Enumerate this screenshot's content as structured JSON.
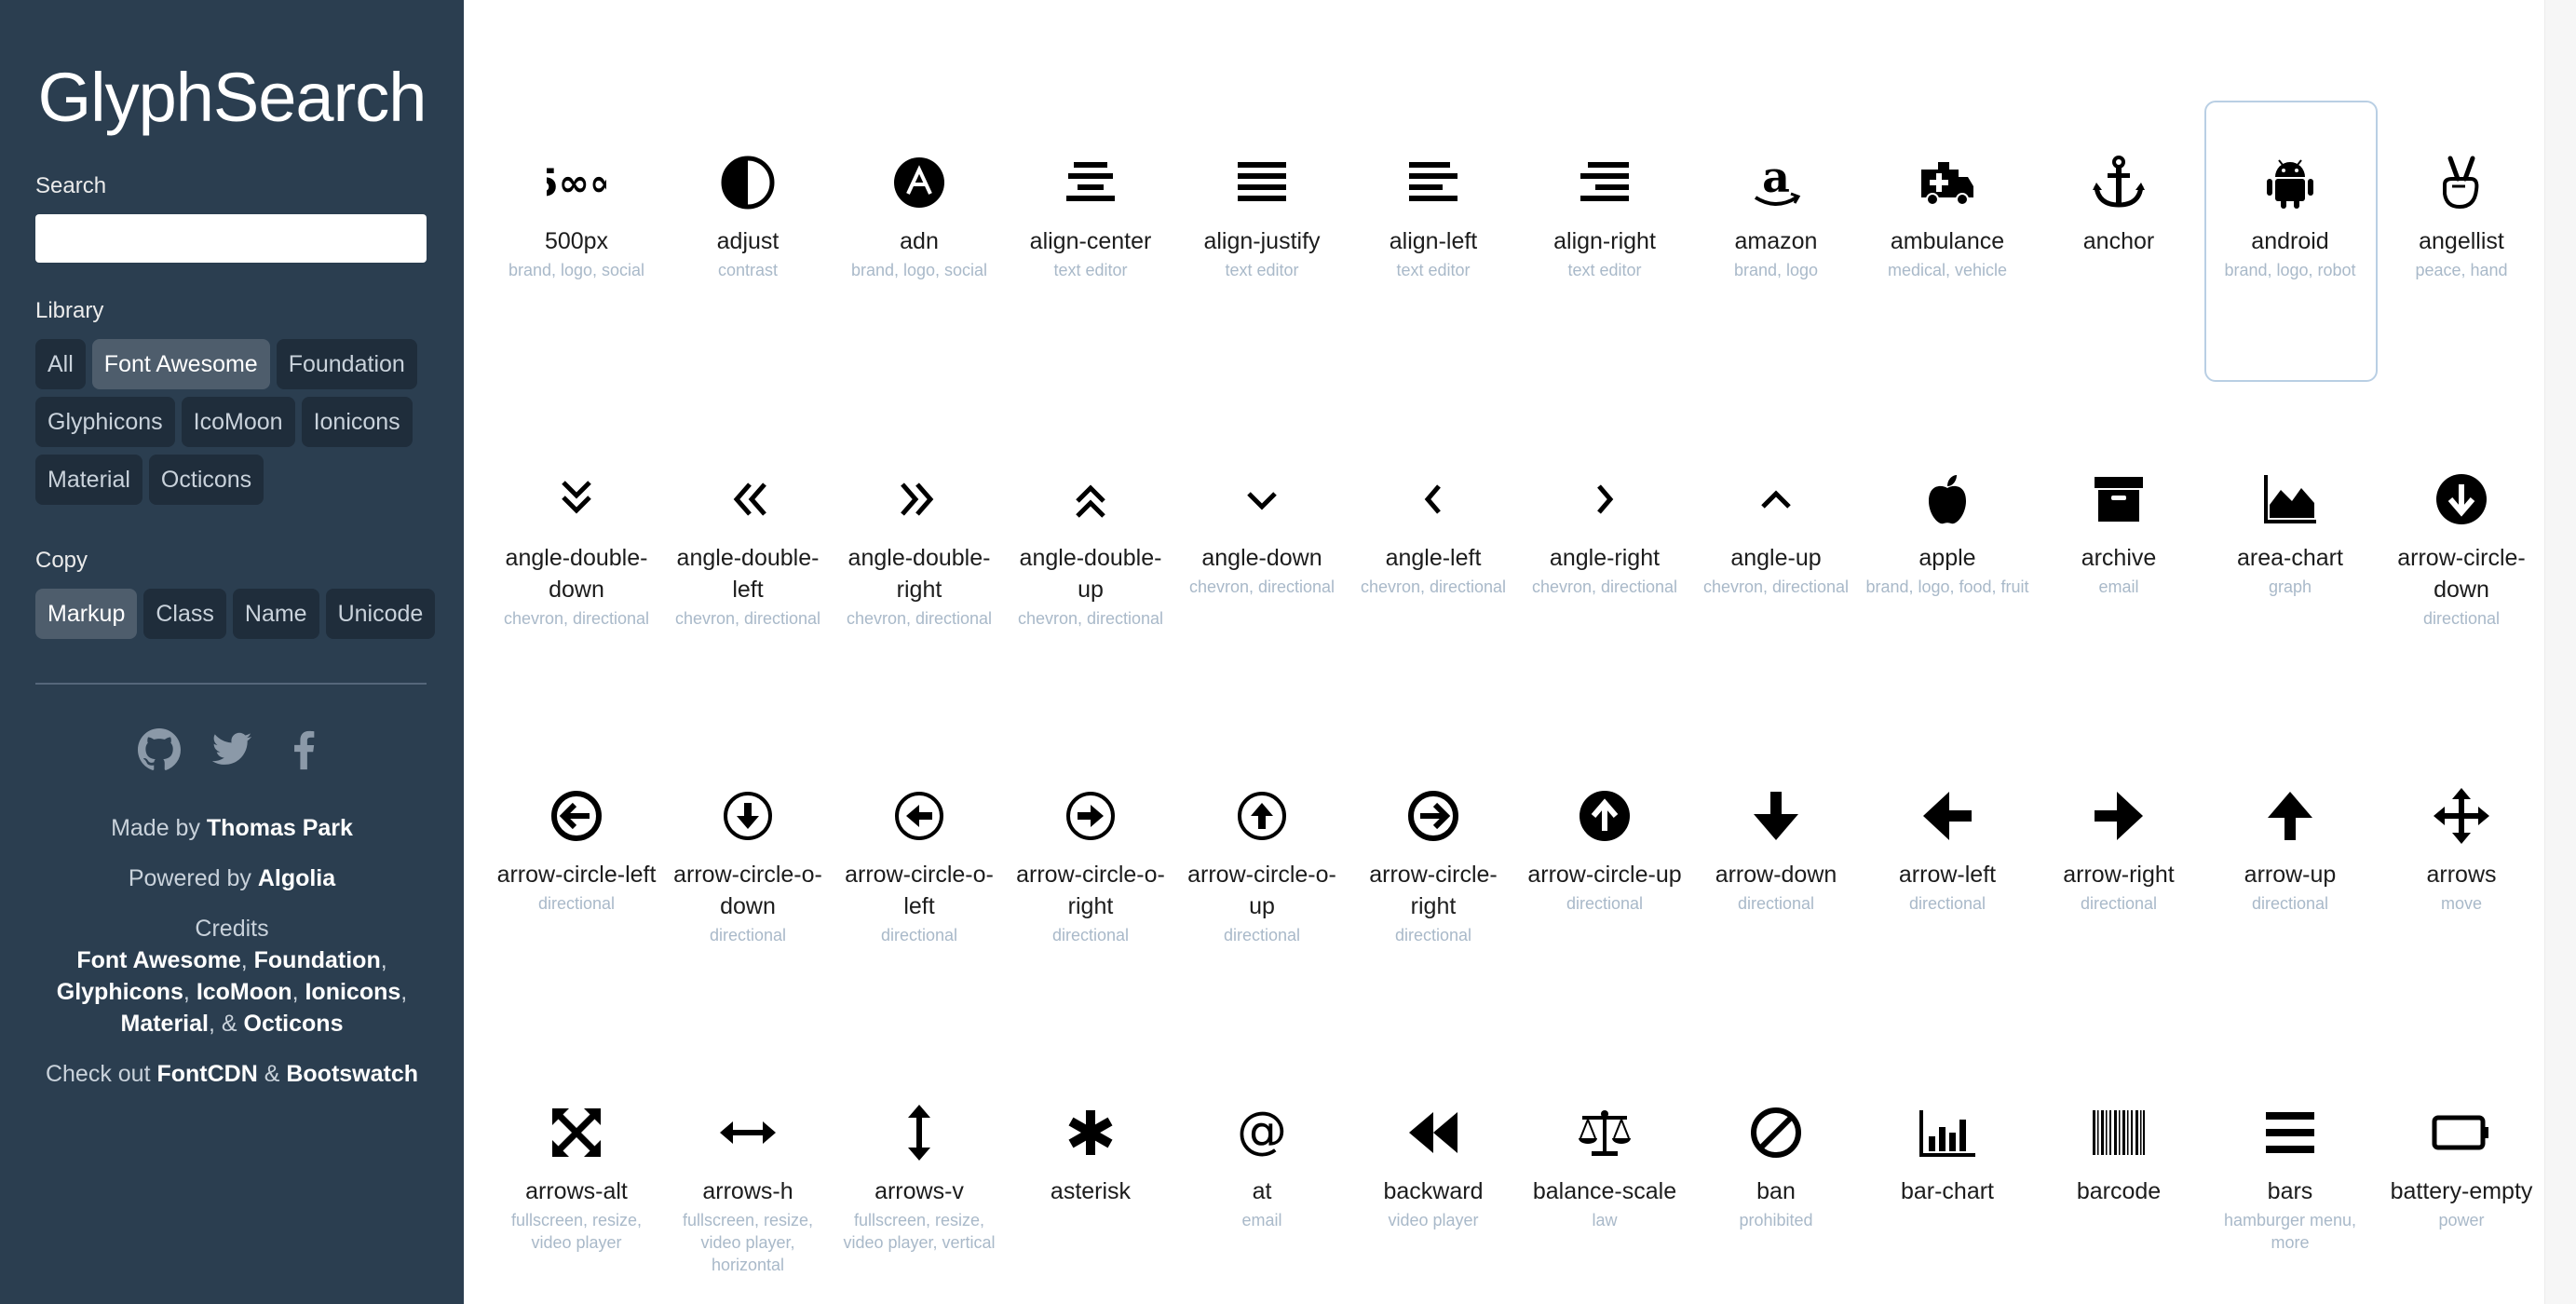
{
  "app": {
    "title": "GlyphSearch"
  },
  "search": {
    "label": "Search",
    "placeholder": "",
    "value": ""
  },
  "library": {
    "label": "Library",
    "rows": [
      [
        {
          "label": "All",
          "active": false
        },
        {
          "label": "Font Awesome",
          "active": true
        },
        {
          "label": "Foundation",
          "active": false
        }
      ],
      [
        {
          "label": "Glyphicons",
          "active": false
        },
        {
          "label": "IcoMoon",
          "active": false
        },
        {
          "label": "Ionicons",
          "active": false
        }
      ],
      [
        {
          "label": "Material",
          "active": false
        },
        {
          "label": "Octicons",
          "active": false
        }
      ]
    ]
  },
  "copy": {
    "label": "Copy",
    "options": [
      {
        "label": "Markup",
        "active": true
      },
      {
        "label": "Class",
        "active": false
      },
      {
        "label": "Name",
        "active": false
      },
      {
        "label": "Unicode",
        "active": false
      }
    ]
  },
  "social": [
    {
      "icon": "github-icon"
    },
    {
      "icon": "twitter-icon"
    },
    {
      "icon": "facebook-icon"
    }
  ],
  "footer": {
    "made_by_prefix": "Made by ",
    "made_by_name": "Thomas Park",
    "powered_prefix": "Powered by ",
    "powered_name": "Algolia",
    "credits_title": "Credits",
    "credits_line1_a": "Font Awesome",
    "credits_line1_sep": ", ",
    "credits_line1_b": "Foundation",
    "credits_line1_end": ",",
    "credits_line2_a": "Glyphicons",
    "credits_line2_b": "IcoMoon",
    "credits_line2_c": "Ionicons",
    "credits_line3_a": "Material",
    "credits_line3_amp": ", & ",
    "credits_line3_b": "Octicons",
    "checkout_prefix": "Check out ",
    "checkout_a": "FontCDN",
    "checkout_amp": " & ",
    "checkout_b": "Bootswatch"
  },
  "colors": {
    "sidebar_bg": "#2b3e50",
    "pill_bg": "#1f2d3b",
    "pill_active_bg": "#4e5d6c",
    "tag_text": "#a9b9c9",
    "selected_border": "#b9cfe4"
  },
  "icons": [
    {
      "name": "500px",
      "tags": "brand, logo, social",
      "glyph": "500px"
    },
    {
      "name": "adjust",
      "tags": "contrast",
      "glyph": "adjust"
    },
    {
      "name": "adn",
      "tags": "brand, logo, social",
      "glyph": "adn"
    },
    {
      "name": "align-center",
      "tags": "text editor",
      "glyph": "align-center"
    },
    {
      "name": "align-justify",
      "tags": "text editor",
      "glyph": "align-justify"
    },
    {
      "name": "align-left",
      "tags": "text editor",
      "glyph": "align-left"
    },
    {
      "name": "align-right",
      "tags": "text editor",
      "glyph": "align-right"
    },
    {
      "name": "amazon",
      "tags": "brand, logo",
      "glyph": "amazon"
    },
    {
      "name": "ambulance",
      "tags": "medical, vehicle",
      "glyph": "ambulance"
    },
    {
      "name": "anchor",
      "tags": "",
      "glyph": "anchor"
    },
    {
      "name": "android",
      "tags": "brand, logo, robot",
      "glyph": "android",
      "selected": true
    },
    {
      "name": "angellist",
      "tags": "peace, hand",
      "glyph": "angellist"
    },
    {
      "name": "angle-double-down",
      "tags": "chevron, directional",
      "glyph": "angle-double-down"
    },
    {
      "name": "angle-double-left",
      "tags": "chevron, directional",
      "glyph": "angle-double-left"
    },
    {
      "name": "angle-double-right",
      "tags": "chevron, directional",
      "glyph": "angle-double-right"
    },
    {
      "name": "angle-double-up",
      "tags": "chevron, directional",
      "glyph": "angle-double-up"
    },
    {
      "name": "angle-down",
      "tags": "chevron, directional",
      "glyph": "angle-down"
    },
    {
      "name": "angle-left",
      "tags": "chevron, directional",
      "glyph": "angle-left"
    },
    {
      "name": "angle-right",
      "tags": "chevron, directional",
      "glyph": "angle-right"
    },
    {
      "name": "angle-up",
      "tags": "chevron, directional",
      "glyph": "angle-up"
    },
    {
      "name": "apple",
      "tags": "brand, logo, food, fruit",
      "glyph": "apple"
    },
    {
      "name": "archive",
      "tags": "email",
      "glyph": "archive"
    },
    {
      "name": "area-chart",
      "tags": "graph",
      "glyph": "area-chart"
    },
    {
      "name": "arrow-circle-down",
      "tags": "directional",
      "glyph": "arrow-circle-down"
    },
    {
      "name": "arrow-circle-left",
      "tags": "directional",
      "glyph": "arrow-circle-left"
    },
    {
      "name": "arrow-circle-o-down",
      "tags": "directional",
      "glyph": "arrow-circle-o-down"
    },
    {
      "name": "arrow-circle-o-left",
      "tags": "directional",
      "glyph": "arrow-circle-o-left"
    },
    {
      "name": "arrow-circle-o-right",
      "tags": "directional",
      "glyph": "arrow-circle-o-right"
    },
    {
      "name": "arrow-circle-o-up",
      "tags": "directional",
      "glyph": "arrow-circle-o-up"
    },
    {
      "name": "arrow-circle-right",
      "tags": "directional",
      "glyph": "arrow-circle-right"
    },
    {
      "name": "arrow-circle-up",
      "tags": "directional",
      "glyph": "arrow-circle-up"
    },
    {
      "name": "arrow-down",
      "tags": "directional",
      "glyph": "arrow-down"
    },
    {
      "name": "arrow-left",
      "tags": "directional",
      "glyph": "arrow-left"
    },
    {
      "name": "arrow-right",
      "tags": "directional",
      "glyph": "arrow-right"
    },
    {
      "name": "arrow-up",
      "tags": "directional",
      "glyph": "arrow-up"
    },
    {
      "name": "arrows",
      "tags": "move",
      "glyph": "arrows"
    },
    {
      "name": "arrows-alt",
      "tags": "fullscreen, resize, video player",
      "glyph": "arrows-alt"
    },
    {
      "name": "arrows-h",
      "tags": "fullscreen, resize, video player, horizontal",
      "glyph": "arrows-h"
    },
    {
      "name": "arrows-v",
      "tags": "fullscreen, resize, video player, vertical",
      "glyph": "arrows-v"
    },
    {
      "name": "asterisk",
      "tags": "",
      "glyph": "asterisk"
    },
    {
      "name": "at",
      "tags": "email",
      "glyph": "at"
    },
    {
      "name": "backward",
      "tags": "video player",
      "glyph": "backward"
    },
    {
      "name": "balance-scale",
      "tags": "law",
      "glyph": "balance-scale"
    },
    {
      "name": "ban",
      "tags": "prohibited",
      "glyph": "ban"
    },
    {
      "name": "bar-chart",
      "tags": "",
      "glyph": "bar-chart"
    },
    {
      "name": "barcode",
      "tags": "",
      "glyph": "barcode"
    },
    {
      "name": "bars",
      "tags": "hamburger menu, more",
      "glyph": "bars"
    },
    {
      "name": "battery-empty",
      "tags": "power",
      "glyph": "battery-empty"
    }
  ]
}
